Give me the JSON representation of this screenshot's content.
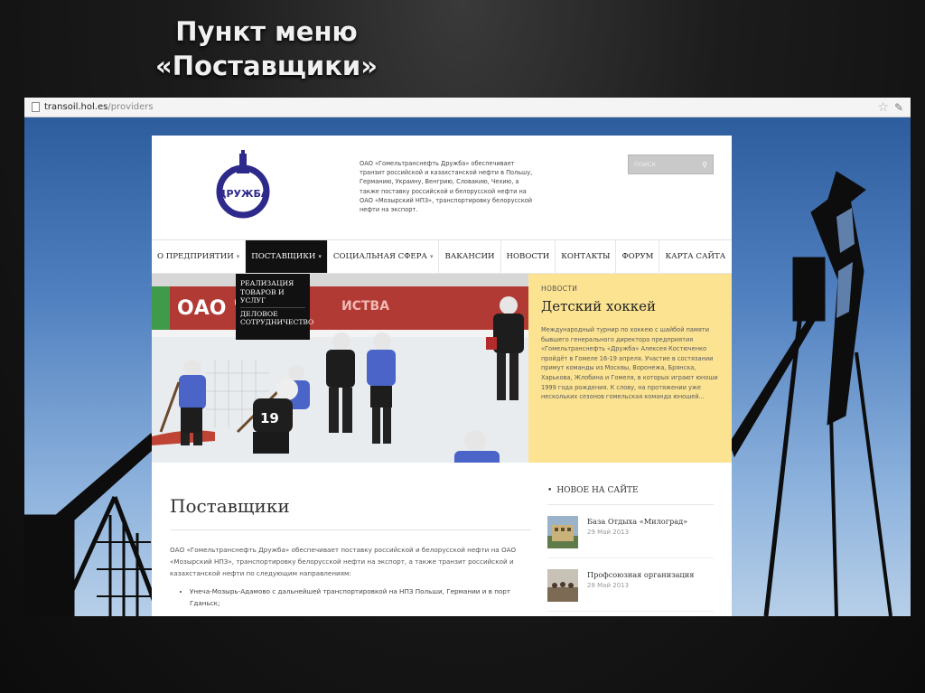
{
  "slide": {
    "title_line1": "Пункт меню",
    "title_line2": "«Поставщики»"
  },
  "browser": {
    "url_host": "transoil.hol.es",
    "url_path": "/providers"
  },
  "header": {
    "logo_text": "ДРУЖБА",
    "description": "ОАО «Гомельтранснефть Дружба» обеспечивает транзит российской и казахстанской нефти в Польшу, Германию, Украину, Венгрию, Словакию, Чехию, а также поставку российской и белорусской нефти на ОАО «Мозырский НПЗ», транспортировку белорусской нефти на экспорт.",
    "search_placeholder": "ПОИСК"
  },
  "nav": {
    "items": [
      {
        "label": "О ПРЕДПРИЯТИИ",
        "has_dropdown": true
      },
      {
        "label": "ПОСТАВЩИКИ",
        "has_dropdown": true,
        "active": true
      },
      {
        "label": "СОЦИАЛЬНАЯ СФЕРА",
        "has_dropdown": true
      },
      {
        "label": "ВАКАНСИИ"
      },
      {
        "label": "НОВОСТИ"
      },
      {
        "label": "КОНТАКТЫ"
      },
      {
        "label": "ФОРУМ"
      },
      {
        "label": "КАРТА САЙТА"
      }
    ],
    "dropdown": [
      "РЕАЛИЗАЦИЯ ТОВАРОВ И УСЛУГ",
      "ДЕЛОВОЕ СОТРУДНИЧЕСТВО"
    ]
  },
  "hero": {
    "banner_text": "ОАО \"ТОМ",
    "banner_text2": "ИСТВА",
    "jersey_number": "19",
    "tag": "НОВОСТИ",
    "title": "Детский хоккей",
    "body": "Международный турнир по хоккею с шайбой памяти бывшего генерального директора предприятия «Гомельтранснефть «Дружба» Алексея Костюченко пройдёт в Гомеле 16-19 апреля. Участие в состязании примут команды из Москвы, Воронежа, Брянска, Харькова, Жлобина и Гомеля, в которых играют юноши 1999 года рождения. К слову, на протяжении уже нескольких сезонов гомельская команда юношей..."
  },
  "main": {
    "heading": "Поставщики",
    "intro": "ОАО «Гомельтранснефть Дружба» обеспечивает поставку российской и белорусской нефти на ОАО «Мозырский НПЗ», транспортировку белорусской нефти на экспорт, а также транзит российской и казахстанской нефти по следующим направлениям:",
    "bullets": [
      "Унеча-Мозырь-Адамово с дальнейшей транспортировкой на НПЗ Польши, Германии и в порт Гданьск;"
    ]
  },
  "sidebar": {
    "title": "НОВОЕ НА САЙТЕ",
    "items": [
      {
        "title": "База Отдыха «Милоград»",
        "date": "29 Май 2013"
      },
      {
        "title": "Профсоюзная организация",
        "date": "28 Май 2013"
      }
    ]
  },
  "colors": {
    "panel_yellow": "#fbe392",
    "nav_active": "#111111",
    "sky_top": "#2e5d9e"
  }
}
